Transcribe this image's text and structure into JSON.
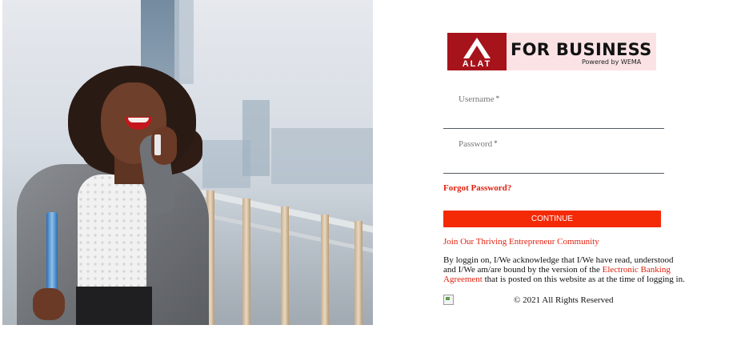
{
  "hero_image": {
    "alt": "woman on phone"
  },
  "logo": {
    "mark_text": "ALAT",
    "title": "FOR BUSINESS",
    "subtitle": "Powered by WEMA",
    "brand_color": "#a7131b",
    "background_color": "#fbe3e5"
  },
  "form": {
    "username_label": "Username",
    "password_label": "Password",
    "required_marker": "*",
    "username_value": "",
    "password_value": ""
  },
  "links": {
    "forgot_password": "Forgot Password?",
    "join_community": "Join Our Thriving Entrepreneur Community"
  },
  "buttons": {
    "continue_label": "CONTINUE"
  },
  "terms": {
    "before": "By loggin on, I/We acknowledge that I/We have read, understood and I/We am/are bound by the version of the ",
    "link": "Electronic Banking Agreement",
    "after": " that is posted on this website as at the time of logging in."
  },
  "footer": {
    "copyright": "© 2021 All Rights Reserved"
  },
  "colors": {
    "accent": "#f42a06",
    "link": "#e0210f",
    "text": "#111111"
  }
}
